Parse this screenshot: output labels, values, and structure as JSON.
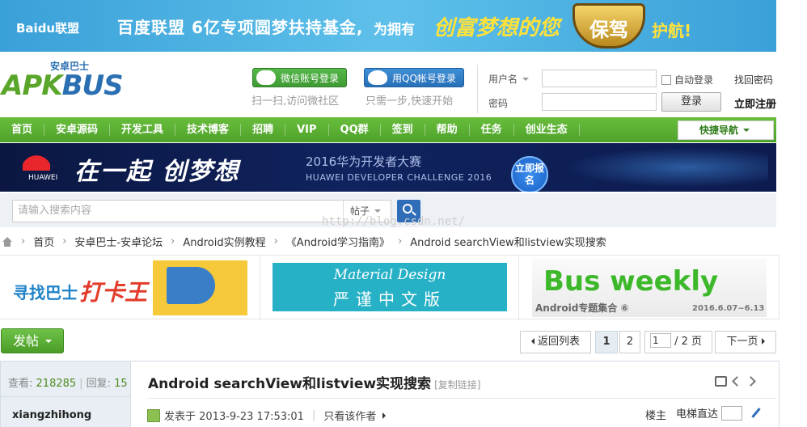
{
  "top_banner": {
    "baidu_logo": "Baidu联盟",
    "slogan_1": "百度联盟 6亿专项圆梦扶持基金,",
    "slogan_2": "为拥有",
    "slogan_3": "创富梦想的您",
    "shield_text": "保驾",
    "slogan_4": "护航!"
  },
  "logo": {
    "subtitle": "安卓巴士",
    "brand_left": "APK",
    "brand_right": "BUS"
  },
  "social_login": {
    "wechat_label": "微信账号登录",
    "wechat_hint": "扫一扫,访问微社区",
    "qq_label": "用QQ帐号登录",
    "qq_hint": "只需一步,快速开始"
  },
  "login": {
    "username_label": "用户名",
    "password_label": "密码",
    "remember_label": "自动登录",
    "find_password": "找回密码",
    "login_button": "登录",
    "register": "立即注册"
  },
  "nav": {
    "items": [
      "首页",
      "安卓源码",
      "开发工具",
      "技术博客",
      "招聘",
      "VIP",
      "QQ群",
      "签到",
      "帮助",
      "任务",
      "创业生态"
    ],
    "quick_nav": "快捷导航"
  },
  "huawei_banner": {
    "brand": "HUAWEI",
    "slogan": "在一起 创梦想",
    "title": "2016华为开发者大赛",
    "subtitle": "HUAWEI DEVELOPER CHALLENGE 2016",
    "button": "立即报名"
  },
  "search": {
    "placeholder": "请输入搜索内容",
    "type": "帖子",
    "watermark": "http://blog.csdn.net/"
  },
  "breadcrumb": [
    "首页",
    "安卓巴士-安卓论坛",
    "Android实例教程",
    "《Android学习指南》",
    "Android searchView和listview实现搜索"
  ],
  "ads": {
    "ad1_text1": "寻找巴士",
    "ad1_text2": "打卡王",
    "ad2_title": "Material Design",
    "ad2_sub": "严谨中文版",
    "ad3_title": "Bus weekly",
    "ad3_sub": "Android专题集合 ⑥",
    "ad3_date": "2016.6.07~6.13"
  },
  "toolbar": {
    "post_button": "发帖",
    "back_to_list": "返回列表",
    "page_1": "1",
    "page_2": "2",
    "page_input": "1",
    "page_total": "/ 2 页",
    "next_page": "下一页"
  },
  "thread": {
    "views_label": "查看:",
    "views": "218285",
    "replies_label": "回复:",
    "replies": "15",
    "author": "xiangzhihong",
    "title": "Android searchView和listview实现搜索",
    "copy_link": "[复制链接]",
    "posted_at": "发表于 2013-9-23 17:53:01",
    "only_author": "只看该作者",
    "floor": "楼主",
    "elevator": "电梯直达"
  }
}
